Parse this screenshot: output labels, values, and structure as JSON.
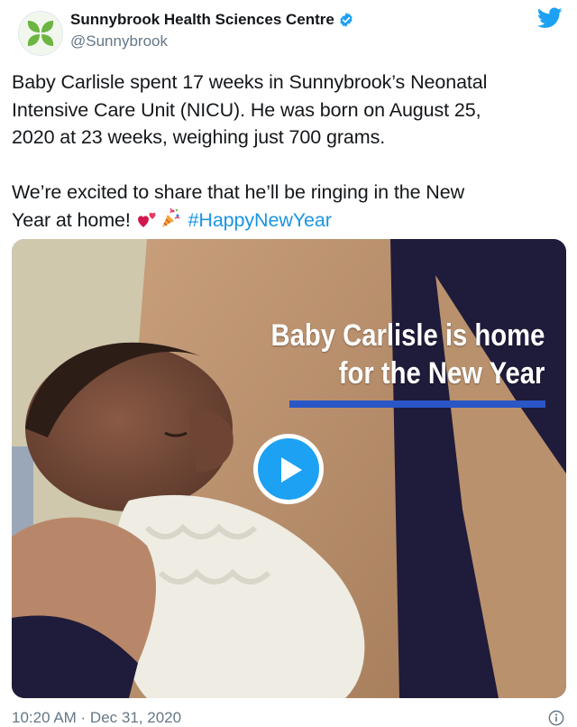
{
  "account": {
    "display_name": "Sunnybrook Health Sciences Centre",
    "handle": "@Sunnybrook",
    "verified": true,
    "avatar_icon": "sunnybrook-leaf-logo",
    "brand_color": "#6bb540"
  },
  "tweet": {
    "text_line1": "Baby Carlisle spent 17 weeks in Sunnybrook’s Neonatal",
    "text_line2": "Intensive Care Unit (NICU). He was born on August 25,",
    "text_line3": "2020 at 23 weeks, weighing just 700 grams.",
    "text_line4": "We’re excited to share that he’ll be ringing in the New",
    "text_line5_start": "Year at home! ",
    "emojis": [
      "two-hearts-emoji",
      "party-popper-emoji"
    ],
    "hashtag": "#HappyNewYear",
    "hashtag_color": "#1b95e0"
  },
  "media": {
    "type": "video",
    "overlay_line1": "Baby Carlisle is home",
    "overlay_line2": "for the New Year",
    "overlay_bar_color": "#2a56c6",
    "play_icon": "play-icon",
    "play_button_color": "#1da1f2"
  },
  "footer": {
    "timestamp": "10:20 AM · Dec 31, 2020",
    "info_icon": "info-icon"
  },
  "icons": {
    "twitter_logo": "twitter-bird-icon",
    "twitter_color": "#1da1f2",
    "verified_badge": "verified-badge-icon"
  }
}
